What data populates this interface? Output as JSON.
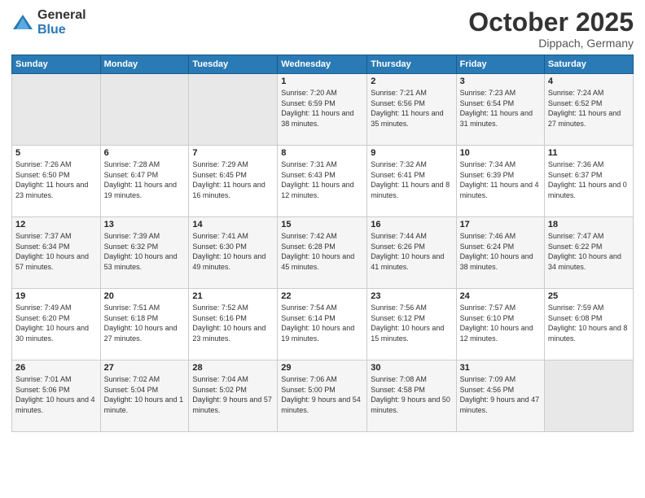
{
  "logo": {
    "general": "General",
    "blue": "Blue"
  },
  "title": "October 2025",
  "location": "Dippach, Germany",
  "days_of_week": [
    "Sunday",
    "Monday",
    "Tuesday",
    "Wednesday",
    "Thursday",
    "Friday",
    "Saturday"
  ],
  "weeks": [
    [
      {
        "day": "",
        "info": ""
      },
      {
        "day": "",
        "info": ""
      },
      {
        "day": "",
        "info": ""
      },
      {
        "day": "1",
        "info": "Sunrise: 7:20 AM\nSunset: 6:59 PM\nDaylight: 11 hours and 38 minutes."
      },
      {
        "day": "2",
        "info": "Sunrise: 7:21 AM\nSunset: 6:56 PM\nDaylight: 11 hours and 35 minutes."
      },
      {
        "day": "3",
        "info": "Sunrise: 7:23 AM\nSunset: 6:54 PM\nDaylight: 11 hours and 31 minutes."
      },
      {
        "day": "4",
        "info": "Sunrise: 7:24 AM\nSunset: 6:52 PM\nDaylight: 11 hours and 27 minutes."
      }
    ],
    [
      {
        "day": "5",
        "info": "Sunrise: 7:26 AM\nSunset: 6:50 PM\nDaylight: 11 hours and 23 minutes."
      },
      {
        "day": "6",
        "info": "Sunrise: 7:28 AM\nSunset: 6:47 PM\nDaylight: 11 hours and 19 minutes."
      },
      {
        "day": "7",
        "info": "Sunrise: 7:29 AM\nSunset: 6:45 PM\nDaylight: 11 hours and 16 minutes."
      },
      {
        "day": "8",
        "info": "Sunrise: 7:31 AM\nSunset: 6:43 PM\nDaylight: 11 hours and 12 minutes."
      },
      {
        "day": "9",
        "info": "Sunrise: 7:32 AM\nSunset: 6:41 PM\nDaylight: 11 hours and 8 minutes."
      },
      {
        "day": "10",
        "info": "Sunrise: 7:34 AM\nSunset: 6:39 PM\nDaylight: 11 hours and 4 minutes."
      },
      {
        "day": "11",
        "info": "Sunrise: 7:36 AM\nSunset: 6:37 PM\nDaylight: 11 hours and 0 minutes."
      }
    ],
    [
      {
        "day": "12",
        "info": "Sunrise: 7:37 AM\nSunset: 6:34 PM\nDaylight: 10 hours and 57 minutes."
      },
      {
        "day": "13",
        "info": "Sunrise: 7:39 AM\nSunset: 6:32 PM\nDaylight: 10 hours and 53 minutes."
      },
      {
        "day": "14",
        "info": "Sunrise: 7:41 AM\nSunset: 6:30 PM\nDaylight: 10 hours and 49 minutes."
      },
      {
        "day": "15",
        "info": "Sunrise: 7:42 AM\nSunset: 6:28 PM\nDaylight: 10 hours and 45 minutes."
      },
      {
        "day": "16",
        "info": "Sunrise: 7:44 AM\nSunset: 6:26 PM\nDaylight: 10 hours and 41 minutes."
      },
      {
        "day": "17",
        "info": "Sunrise: 7:46 AM\nSunset: 6:24 PM\nDaylight: 10 hours and 38 minutes."
      },
      {
        "day": "18",
        "info": "Sunrise: 7:47 AM\nSunset: 6:22 PM\nDaylight: 10 hours and 34 minutes."
      }
    ],
    [
      {
        "day": "19",
        "info": "Sunrise: 7:49 AM\nSunset: 6:20 PM\nDaylight: 10 hours and 30 minutes."
      },
      {
        "day": "20",
        "info": "Sunrise: 7:51 AM\nSunset: 6:18 PM\nDaylight: 10 hours and 27 minutes."
      },
      {
        "day": "21",
        "info": "Sunrise: 7:52 AM\nSunset: 6:16 PM\nDaylight: 10 hours and 23 minutes."
      },
      {
        "day": "22",
        "info": "Sunrise: 7:54 AM\nSunset: 6:14 PM\nDaylight: 10 hours and 19 minutes."
      },
      {
        "day": "23",
        "info": "Sunrise: 7:56 AM\nSunset: 6:12 PM\nDaylight: 10 hours and 15 minutes."
      },
      {
        "day": "24",
        "info": "Sunrise: 7:57 AM\nSunset: 6:10 PM\nDaylight: 10 hours and 12 minutes."
      },
      {
        "day": "25",
        "info": "Sunrise: 7:59 AM\nSunset: 6:08 PM\nDaylight: 10 hours and 8 minutes."
      }
    ],
    [
      {
        "day": "26",
        "info": "Sunrise: 7:01 AM\nSunset: 5:06 PM\nDaylight: 10 hours and 4 minutes."
      },
      {
        "day": "27",
        "info": "Sunrise: 7:02 AM\nSunset: 5:04 PM\nDaylight: 10 hours and 1 minute."
      },
      {
        "day": "28",
        "info": "Sunrise: 7:04 AM\nSunset: 5:02 PM\nDaylight: 9 hours and 57 minutes."
      },
      {
        "day": "29",
        "info": "Sunrise: 7:06 AM\nSunset: 5:00 PM\nDaylight: 9 hours and 54 minutes."
      },
      {
        "day": "30",
        "info": "Sunrise: 7:08 AM\nSunset: 4:58 PM\nDaylight: 9 hours and 50 minutes."
      },
      {
        "day": "31",
        "info": "Sunrise: 7:09 AM\nSunset: 4:56 PM\nDaylight: 9 hours and 47 minutes."
      },
      {
        "day": "",
        "info": ""
      }
    ]
  ]
}
